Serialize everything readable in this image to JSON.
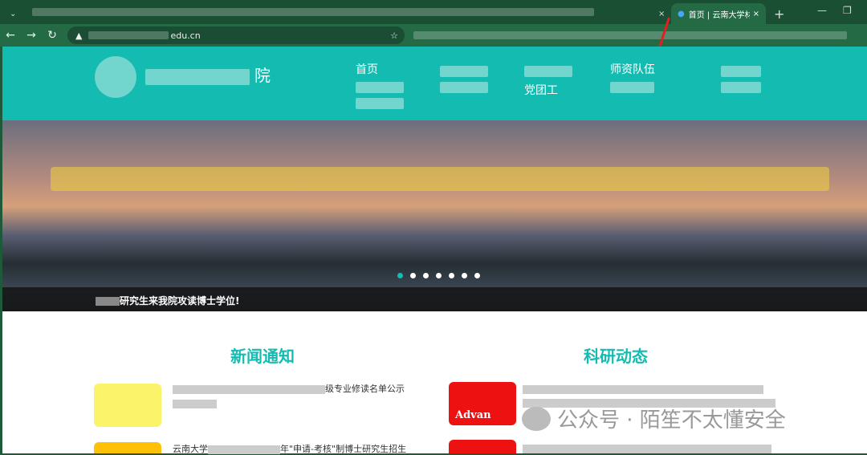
{
  "browser": {
    "active_tab_title": "首页 | 云南大学材料",
    "address_suffix": "edu.cn",
    "new_tab": "+",
    "close": "×",
    "minimize": "—",
    "restore": "❐"
  },
  "site": {
    "name_visible": "院",
    "nav": [
      {
        "label": "首页"
      },
      {
        "label": ""
      },
      {
        "label": "党团工"
      },
      {
        "label": "师资队伍"
      },
      {
        "label": ""
      }
    ],
    "banner_caption": "研究生来我院攻读博士学位!",
    "slides": 7,
    "active_slide": 1
  },
  "sections": {
    "news": {
      "title": "新闻通知",
      "items": [
        {
          "title": "级专业修读名单公示"
        },
        {
          "title": "年\"申请-考核\"制博士研究生招生",
          "prefix": "云南大学"
        }
      ]
    },
    "research": {
      "title": "科研动态",
      "items": [
        {
          "thumb_text": "Advan"
        },
        {
          "thumb_text": ""
        }
      ]
    }
  },
  "watermark": "公众号 · 陌笙不太懂安全",
  "colors": {
    "accent": "#14bbb0"
  }
}
